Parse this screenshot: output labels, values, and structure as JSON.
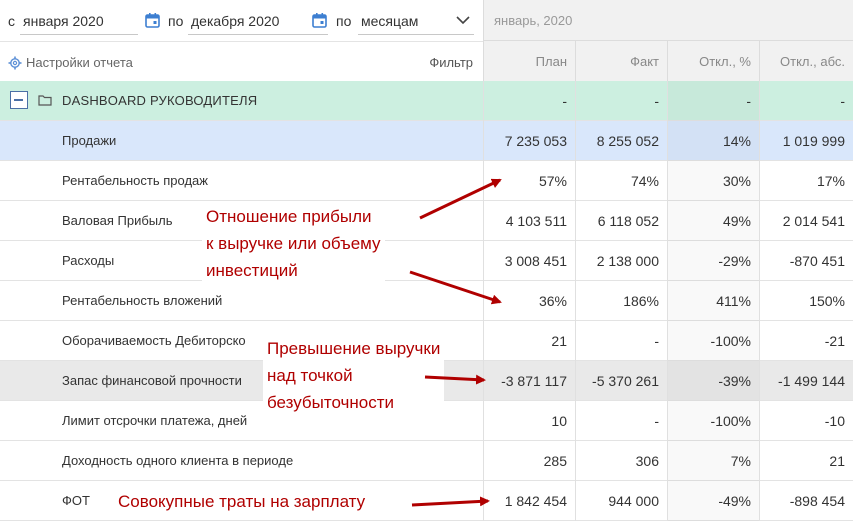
{
  "toolbar": {
    "from_label": "с",
    "from_value": "января 2020",
    "to_label": "по",
    "to_value": "декабря 2020",
    "by_label": "по",
    "period_value": "месяцам",
    "settings_label": "Настройки отчета",
    "filter_label": "Фильтр"
  },
  "header": {
    "month": "январь, 2020",
    "columns": [
      "План",
      "Факт",
      "Откл., %",
      "Откл., абс."
    ]
  },
  "rows": [
    {
      "name": "DASHBOARD РУКОВОДИТЕЛЯ",
      "values": [
        "-",
        "-",
        "-",
        "-"
      ]
    },
    {
      "name": "Продажи",
      "values": [
        "7 235 053",
        "8 255 052",
        "14%",
        "1 019 999"
      ]
    },
    {
      "name": "Рентабельность продаж",
      "values": [
        "57%",
        "74%",
        "30%",
        "17%"
      ]
    },
    {
      "name": "Валовая Прибыль",
      "values": [
        "4 103 511",
        "6 118 052",
        "49%",
        "2 014 541"
      ]
    },
    {
      "name": "Расходы",
      "values": [
        "3 008 451",
        "2 138 000",
        "-29%",
        "-870 451"
      ]
    },
    {
      "name": "Рентабельность вложений",
      "values": [
        "36%",
        "186%",
        "411%",
        "150%"
      ]
    },
    {
      "name": "Оборачиваемость Дебиторско",
      "values": [
        "21",
        "-",
        "-100%",
        "-21"
      ]
    },
    {
      "name": "Запас финансовой прочности",
      "values": [
        "-3 871 117",
        "-5 370 261",
        "-39%",
        "-1 499 144"
      ]
    },
    {
      "name": "Лимит отсрочки платежа, дней",
      "values": [
        "10",
        "-",
        "-100%",
        "-10"
      ]
    },
    {
      "name": "Доходность одного клиента в периоде",
      "values": [
        "285",
        "306",
        "7%",
        "21"
      ]
    },
    {
      "name": "ФОТ",
      "values": [
        "1 842 454",
        "944 000",
        "-49%",
        "-898 454"
      ]
    }
  ],
  "annotations": {
    "profit_ratio": [
      "Отношение прибыли",
      "к выручке или объему",
      "инвестиций"
    ],
    "breakeven": [
      "Превышение выручки",
      "над точкой",
      "безубыточности"
    ],
    "payroll": "Совокупные траты на зарплату"
  },
  "colors": {
    "dashboard_row": "#ccefe0",
    "sales_row": "#d9e7fb",
    "annotation": "#b00000",
    "icon_blue": "#3d7fd1"
  }
}
